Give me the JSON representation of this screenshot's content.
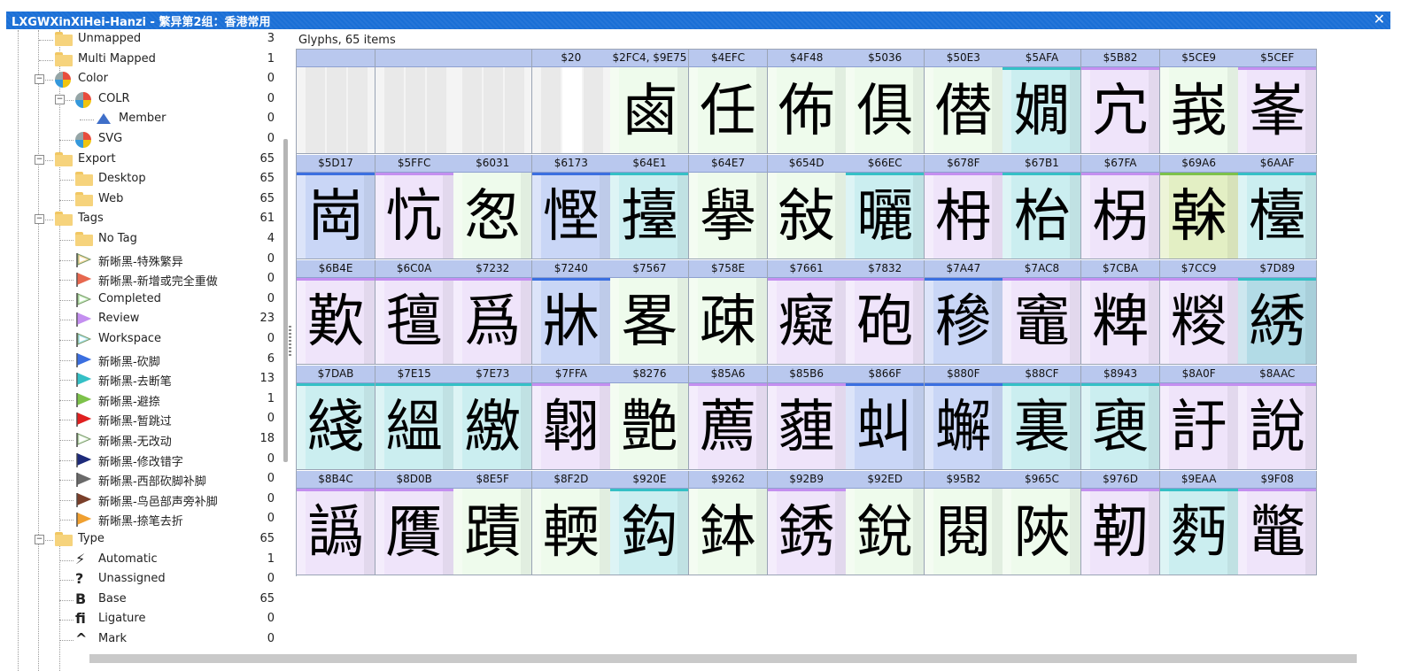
{
  "window": {
    "title": "LXGWXinXiHei-Hanzi - 繁异第2组：香港常用"
  },
  "tree": [
    {
      "label": "Unmapped",
      "count": "3",
      "icon": "folder-icon",
      "level": 1
    },
    {
      "label": "Multi Mapped",
      "count": "1",
      "icon": "folder-icon",
      "level": 1
    },
    {
      "label": "Color",
      "count": "0",
      "icon": "pie-chart-icon",
      "level": 1,
      "expander": "−"
    },
    {
      "label": "COLR",
      "count": "0",
      "icon": "pie-chart-icon",
      "level": 2,
      "expander": "−"
    },
    {
      "label": "Member",
      "count": "0",
      "icon": "triangle-icon",
      "level": 3
    },
    {
      "label": "SVG",
      "count": "0",
      "icon": "pie-chart-icon",
      "level": 2
    },
    {
      "label": "Export",
      "count": "65",
      "icon": "folder-icon",
      "level": 1,
      "expander": "−"
    },
    {
      "label": "Desktop",
      "count": "65",
      "icon": "folder-icon",
      "level": 2
    },
    {
      "label": "Web",
      "count": "65",
      "icon": "folder-icon",
      "level": 2
    },
    {
      "label": "Tags",
      "count": "61",
      "icon": "folder-icon",
      "level": 1,
      "expander": "−"
    },
    {
      "label": "No Tag",
      "count": "4",
      "icon": "folder-icon",
      "level": 2
    },
    {
      "label": "新晰黑-特殊繁异",
      "count": "0",
      "icon": "flag-icon",
      "flag": "#f6d89e",
      "outline": true,
      "level": 2
    },
    {
      "label": "新晰黑-新增或完全重做",
      "count": "0",
      "icon": "flag-icon",
      "flag": "#e7684f",
      "level": 2
    },
    {
      "label": "Completed",
      "count": "0",
      "icon": "flag-icon",
      "flag": "#c8f0c0",
      "outline": true,
      "level": 2
    },
    {
      "label": "Review",
      "count": "23",
      "icon": "flag-icon",
      "flag": "#c48ff0",
      "level": 2
    },
    {
      "label": "Workspace",
      "count": "0",
      "icon": "flag-icon",
      "flag": "#aee7f2",
      "outline": true,
      "level": 2
    },
    {
      "label": "新晰黑-砍脚",
      "count": "6",
      "icon": "flag-icon",
      "flag": "#3b6fe0",
      "level": 2
    },
    {
      "label": "新晰黑-去断笔",
      "count": "13",
      "icon": "flag-icon",
      "flag": "#35c0c6",
      "level": 2
    },
    {
      "label": "新晰黑-避捺",
      "count": "1",
      "icon": "flag-icon",
      "flag": "#7dc24a",
      "level": 2
    },
    {
      "label": "新晰黑-暂跳过",
      "count": "0",
      "icon": "flag-icon",
      "flag": "#e02020",
      "level": 2
    },
    {
      "label": "新晰黑-无改动",
      "count": "18",
      "icon": "flag-icon",
      "flag": "#e8f8e4",
      "outline": true,
      "level": 2
    },
    {
      "label": "新晰黑-修改错字",
      "count": "0",
      "icon": "flag-icon",
      "flag": "#1d2a7a",
      "level": 2
    },
    {
      "label": "新晰黑-西部砍脚补脚",
      "count": "0",
      "icon": "flag-icon",
      "flag": "#6a6a6a",
      "level": 2
    },
    {
      "label": "新晰黑-鸟邑部声旁补脚",
      "count": "0",
      "icon": "flag-icon",
      "flag": "#7a3f2a",
      "level": 2
    },
    {
      "label": "新晰黑-捺笔去折",
      "count": "0",
      "icon": "flag-icon",
      "flag": "#f0a030",
      "level": 2
    },
    {
      "label": "Type",
      "count": "65",
      "icon": "folder-icon",
      "level": 1,
      "expander": "−"
    },
    {
      "label": "Automatic",
      "count": "1",
      "icon": "lightning-icon",
      "glyph": "⚡",
      "level": 2
    },
    {
      "label": "Unassigned",
      "count": "0",
      "icon": "question-icon",
      "glyph": "?",
      "level": 2
    },
    {
      "label": "Base",
      "count": "65",
      "icon": "base-icon",
      "glyph": "B",
      "level": 2
    },
    {
      "label": "Ligature",
      "count": "0",
      "icon": "ligature-icon",
      "glyph": "ﬁ",
      "level": 2
    },
    {
      "label": "Mark",
      "count": "0",
      "icon": "mark-icon",
      "glyph": "^",
      "level": 2
    }
  ],
  "glyphs_panel": {
    "header": "Glyphs, 65 items"
  },
  "glyphs": [
    {
      "code": "",
      "char": "",
      "bg": "#f4f4f4",
      "empty": true
    },
    {
      "code": "",
      "char": "",
      "bg": "#f4f4f4",
      "empty": true
    },
    {
      "code": "",
      "char": "",
      "bg": "#f4f4f4",
      "empty": true
    },
    {
      "code": "$20",
      "char": "",
      "bg": "#f4f4f4",
      "empty": true
    },
    {
      "code": "$2FC4, $9E75",
      "char": "鹵",
      "bg": "#eefbec",
      "tag": ""
    },
    {
      "code": "$4EFC",
      "char": "任",
      "bg": "#eefbec",
      "tag": ""
    },
    {
      "code": "$4F48",
      "char": "佈",
      "bg": "#eefbec",
      "tag": ""
    },
    {
      "code": "$5036",
      "char": "俱",
      "bg": "#eefbec",
      "tag": ""
    },
    {
      "code": "$50E3",
      "char": "僣",
      "bg": "#eefbec",
      "tag": ""
    },
    {
      "code": "$5AFA",
      "char": "嫺",
      "bg": "#cbeef0",
      "tag": "#35c0c6"
    },
    {
      "code": "$5B82",
      "char": "宂",
      "bg": "#efe4fa",
      "tag": "#c48ff0"
    },
    {
      "code": "$5CE9",
      "char": "峩",
      "bg": "#eefbec",
      "tag": ""
    },
    {
      "code": "$5CEF",
      "char": "峯",
      "bg": "#efe4fa",
      "tag": "#c48ff0"
    },
    {
      "code": "$5D17",
      "char": "崗",
      "bg": "#c9d6f6",
      "tag": "#3b6fe0"
    },
    {
      "code": "$5FFC",
      "char": "忼",
      "bg": "#efe4fa",
      "tag": "#c48ff0"
    },
    {
      "code": "$6031",
      "char": "怱",
      "bg": "#eefbec",
      "tag": ""
    },
    {
      "code": "$6173",
      "char": "慳",
      "bg": "#c9d6f6",
      "tag": "#3b6fe0"
    },
    {
      "code": "$64E1",
      "char": "擡",
      "bg": "#cbeef0",
      "tag": "#35c0c6"
    },
    {
      "code": "$64E7",
      "char": "擧",
      "bg": "#eefbec",
      "tag": ""
    },
    {
      "code": "$654D",
      "char": "敍",
      "bg": "#eefbec",
      "tag": ""
    },
    {
      "code": "$66EC",
      "char": "曬",
      "bg": "#cbeef0",
      "tag": "#35c0c6"
    },
    {
      "code": "$678F",
      "char": "枏",
      "bg": "#efe4fa",
      "tag": "#c48ff0"
    },
    {
      "code": "$67B1",
      "char": "枱",
      "bg": "#cbeef0",
      "tag": "#35c0c6"
    },
    {
      "code": "$67FA",
      "char": "柺",
      "bg": "#efe4fa",
      "tag": "#c48ff0"
    },
    {
      "code": "$69A6",
      "char": "榦",
      "bg": "#e3efc4",
      "tag": "#7dc24a"
    },
    {
      "code": "$6AAF",
      "char": "檯",
      "bg": "#cbeef0",
      "tag": "#35c0c6"
    },
    {
      "code": "$6B4E",
      "char": "歎",
      "bg": "#efe4fa",
      "tag": "#c48ff0"
    },
    {
      "code": "$6C0A",
      "char": "氊",
      "bg": "#efe4fa",
      "tag": "#c48ff0"
    },
    {
      "code": "$7232",
      "char": "爲",
      "bg": "#efe4fa",
      "tag": "#c48ff0"
    },
    {
      "code": "$7240",
      "char": "牀",
      "bg": "#c9d6f6",
      "tag": "#3b6fe0"
    },
    {
      "code": "$7567",
      "char": "畧",
      "bg": "#eefbec",
      "tag": ""
    },
    {
      "code": "$758E",
      "char": "疎",
      "bg": "#eefbec",
      "tag": ""
    },
    {
      "code": "$7661",
      "char": "癡",
      "bg": "#efe4fa",
      "tag": "#c48ff0"
    },
    {
      "code": "$7832",
      "char": "砲",
      "bg": "#efe4fa",
      "tag": "#c48ff0"
    },
    {
      "code": "$7A47",
      "char": "穇",
      "bg": "#c9d6f6",
      "tag": "#3b6fe0"
    },
    {
      "code": "$7AC8",
      "char": "竈",
      "bg": "#efe4fa",
      "tag": "#c48ff0"
    },
    {
      "code": "$7CBA",
      "char": "粺",
      "bg": "#efe4fa",
      "tag": "#c48ff0"
    },
    {
      "code": "$7CC9",
      "char": "糉",
      "bg": "#efe4fa",
      "tag": "#c48ff0"
    },
    {
      "code": "$7D89",
      "char": "綉",
      "bg": "#b2dbe6",
      "tag": "#35c0c6",
      "selected": true
    },
    {
      "code": "$7DAB",
      "char": "綫",
      "bg": "#cbeef0",
      "tag": "#35c0c6"
    },
    {
      "code": "$7E15",
      "char": "縕",
      "bg": "#cbeef0",
      "tag": "#35c0c6"
    },
    {
      "code": "$7E73",
      "char": "繳",
      "bg": "#cbeef0",
      "tag": "#35c0c6"
    },
    {
      "code": "$7FFA",
      "char": "翺",
      "bg": "#efe4fa",
      "tag": "#c48ff0"
    },
    {
      "code": "$8276",
      "char": "艶",
      "bg": "#eefbec",
      "tag": ""
    },
    {
      "code": "$85A6",
      "char": "薦",
      "bg": "#efe4fa",
      "tag": "#c48ff0"
    },
    {
      "code": "$85B6",
      "char": "薶",
      "bg": "#efe4fa",
      "tag": "#c48ff0"
    },
    {
      "code": "$866F",
      "char": "虯",
      "bg": "#c9d6f6",
      "tag": "#3b6fe0"
    },
    {
      "code": "$880F",
      "char": "蠏",
      "bg": "#c9d6f6",
      "tag": "#3b6fe0"
    },
    {
      "code": "$88CF",
      "char": "裏",
      "bg": "#cbeef0",
      "tag": "#35c0c6"
    },
    {
      "code": "$8943",
      "char": "褏",
      "bg": "#cbeef0",
      "tag": "#35c0c6"
    },
    {
      "code": "$8A0F",
      "char": "訏",
      "bg": "#efe4fa",
      "tag": "#c48ff0"
    },
    {
      "code": "$8AAC",
      "char": "說",
      "bg": "#efe4fa",
      "tag": "#c48ff0"
    },
    {
      "code": "$8B4C",
      "char": "譌",
      "bg": "#efe4fa",
      "tag": "#c48ff0"
    },
    {
      "code": "$8D0B",
      "char": "贋",
      "bg": "#efe4fa",
      "tag": "#c48ff0"
    },
    {
      "code": "$8E5F",
      "char": "蹟",
      "bg": "#eefbec",
      "tag": ""
    },
    {
      "code": "$8F2D",
      "char": "輭",
      "bg": "#eefbec",
      "tag": ""
    },
    {
      "code": "$920E",
      "char": "鈎",
      "bg": "#cbeef0",
      "tag": "#35c0c6"
    },
    {
      "code": "$9262",
      "char": "鉢",
      "bg": "#eefbec",
      "tag": ""
    },
    {
      "code": "$92B9",
      "char": "銹",
      "bg": "#efe4fa",
      "tag": "#c48ff0"
    },
    {
      "code": "$92ED",
      "char": "銳",
      "bg": "#eefbec",
      "tag": ""
    },
    {
      "code": "$95B2",
      "char": "閱",
      "bg": "#eefbec",
      "tag": ""
    },
    {
      "code": "$965C",
      "char": "陜",
      "bg": "#eefbec",
      "tag": ""
    },
    {
      "code": "$976D",
      "char": "靭",
      "bg": "#efe4fa",
      "tag": "#c48ff0"
    },
    {
      "code": "$9EAA",
      "char": "麪",
      "bg": "#cbeef0",
      "tag": "#35c0c6"
    },
    {
      "code": "$9F08",
      "char": "鼈",
      "bg": "#efe4fa",
      "tag": "#c48ff0"
    }
  ]
}
